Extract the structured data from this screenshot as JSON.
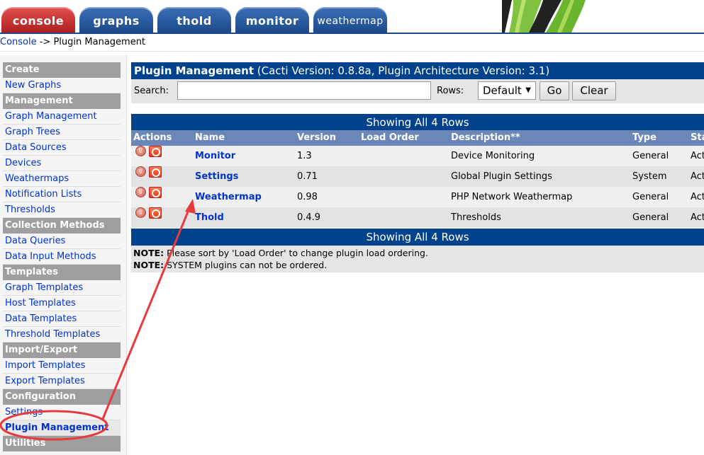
{
  "tabs": {
    "console": "console",
    "graphs": "graphs",
    "thold": "thold",
    "monitor": "monitor",
    "weathermap": "weathermap"
  },
  "breadcrumb": {
    "root": "Console",
    "separator": " -> ",
    "current": "Plugin Management"
  },
  "sidebar": {
    "create_header": "Create",
    "new_graphs": "New Graphs",
    "management_header": "Management",
    "graph_management": "Graph Management",
    "graph_trees": "Graph Trees",
    "data_sources": "Data Sources",
    "devices": "Devices",
    "weathermaps": "Weathermaps",
    "notification_lists": "Notification Lists",
    "thresholds": "Thresholds",
    "collection_header": "Collection Methods",
    "data_queries": "Data Queries",
    "data_input_methods": "Data Input Methods",
    "templates_header": "Templates",
    "graph_templates": "Graph Templates",
    "host_templates": "Host Templates",
    "data_templates": "Data Templates",
    "threshold_templates": "Threshold Templates",
    "import_export_header": "Import/Export",
    "import_templates": "Import Templates",
    "export_templates": "Export Templates",
    "configuration_header": "Configuration",
    "settings": "Settings",
    "plugin_management": "Plugin Management",
    "utilities_header": "Utilities"
  },
  "main": {
    "title_bold": "Plugin Management",
    "title_rest": " (Cacti Version: 0.8.8a, Plugin Architecture Version: 3.1)",
    "search_label": "Search:",
    "search_value": "",
    "rows_label": "Rows:",
    "rows_value": "Default",
    "go_label": "Go",
    "clear_label": "Clear",
    "showing_top": "Showing All 4 Rows",
    "showing_bottom": "Showing All 4 Rows",
    "columns": {
      "actions": "Actions",
      "name": "Name",
      "version": "Version",
      "load_order": "Load Order",
      "description": "Description**",
      "type": "Type",
      "status": "Sta"
    },
    "rows": [
      {
        "name": "Monitor",
        "version": "1.3",
        "load_order": "",
        "description": "Device Monitoring",
        "type": "General",
        "status": "Act"
      },
      {
        "name": "Settings",
        "version": "0.71",
        "load_order": "",
        "description": "Global Plugin Settings",
        "type": "System",
        "status": "Act"
      },
      {
        "name": "Weathermap",
        "version": "0.98",
        "load_order": "",
        "description": "PHP Network Weathermap",
        "type": "General",
        "status": "Act"
      },
      {
        "name": "Thold",
        "version": "0.4.9",
        "load_order": "",
        "description": "Thresholds",
        "type": "General",
        "status": "Act"
      }
    ],
    "note1_label": "NOTE:",
    "note1_text": " Please sort by 'Load Order' to change plugin load ordering.",
    "note2_label": "NOTE:",
    "note2_text": " SYSTEM plugins can not be ordered."
  },
  "colors": {
    "header_blue": "#00438c",
    "column_header": "#6a87b8",
    "console_tab": "#c62828",
    "annotation_red": "#e83a3a"
  },
  "icons": {
    "move_up": "arrow-up-circle-icon",
    "disable": "power-icon",
    "select_caret": "triangle-down-icon"
  }
}
